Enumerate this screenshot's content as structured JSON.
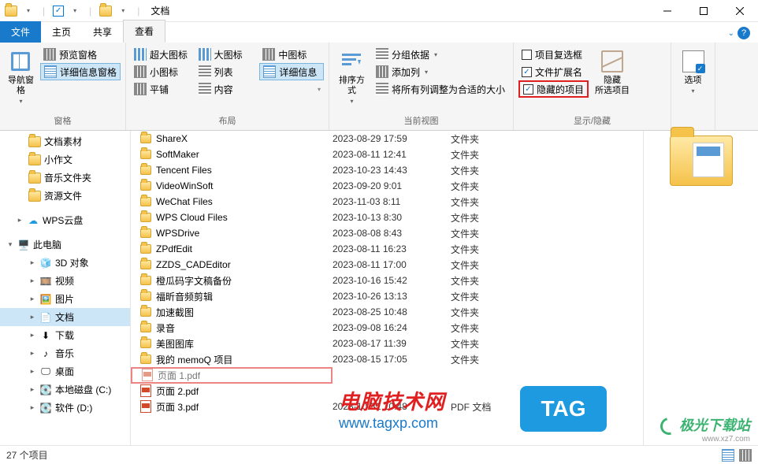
{
  "window": {
    "title": "文档"
  },
  "tabs": {
    "file": "文件",
    "home": "主页",
    "share": "共享",
    "view": "查看"
  },
  "ribbon": {
    "panes": {
      "label": "窗格",
      "nav": "导航窗格",
      "preview": "预览窗格",
      "details": "详细信息窗格"
    },
    "layout": {
      "label": "布局",
      "extra_large": "超大图标",
      "large": "大图标",
      "medium": "中图标",
      "small": "小图标",
      "list": "列表",
      "details": "详细信息",
      "tiles": "平铺",
      "content": "内容"
    },
    "current_view": {
      "label": "当前视图",
      "sort": "排序方式",
      "group": "分组依据",
      "add_columns": "添加列",
      "size_all": "将所有列调整为合适的大小"
    },
    "show_hide": {
      "label": "显示/隐藏",
      "checkboxes": "项目复选框",
      "extensions": "文件扩展名",
      "hidden_items": "隐藏的项目",
      "hide": "隐藏",
      "hide_sub": "所选项目"
    },
    "options": {
      "label": "选项"
    }
  },
  "tree": {
    "items": [
      {
        "icon": "folder",
        "label": "文档素材"
      },
      {
        "icon": "folder",
        "label": "小作文"
      },
      {
        "icon": "folder",
        "label": "音乐文件夹"
      },
      {
        "icon": "folder",
        "label": "资源文件"
      }
    ],
    "wps": "WPS云盘",
    "this_pc": "此电脑",
    "pc_items": [
      {
        "icon": "3d",
        "label": "3D 对象"
      },
      {
        "icon": "video",
        "label": "视频"
      },
      {
        "icon": "image",
        "label": "图片"
      },
      {
        "icon": "doc",
        "label": "文档",
        "selected": true
      },
      {
        "icon": "download",
        "label": "下载"
      },
      {
        "icon": "music",
        "label": "音乐"
      },
      {
        "icon": "desktop",
        "label": "桌面"
      },
      {
        "icon": "disk",
        "label": "本地磁盘 (C:)"
      },
      {
        "icon": "disk",
        "label": "软件 (D:)"
      }
    ]
  },
  "files": [
    {
      "name": "ShareX",
      "date": "2023-08-29 17:59",
      "type": "文件夹",
      "kind": "folder"
    },
    {
      "name": "SoftMaker",
      "date": "2023-08-11 12:41",
      "type": "文件夹",
      "kind": "folder"
    },
    {
      "name": "Tencent Files",
      "date": "2023-10-23 14:43",
      "type": "文件夹",
      "kind": "folder"
    },
    {
      "name": "VideoWinSoft",
      "date": "2023-09-20 9:01",
      "type": "文件夹",
      "kind": "folder"
    },
    {
      "name": "WeChat Files",
      "date": "2023-11-03 8:11",
      "type": "文件夹",
      "kind": "folder"
    },
    {
      "name": "WPS Cloud Files",
      "date": "2023-10-13 8:30",
      "type": "文件夹",
      "kind": "folder"
    },
    {
      "name": "WPSDrive",
      "date": "2023-08-08 8:43",
      "type": "文件夹",
      "kind": "folder"
    },
    {
      "name": "ZPdfEdit",
      "date": "2023-08-11 16:23",
      "type": "文件夹",
      "kind": "folder"
    },
    {
      "name": "ZZDS_CADEditor",
      "date": "2023-08-11 17:00",
      "type": "文件夹",
      "kind": "folder"
    },
    {
      "name": "橙瓜码字文稿备份",
      "date": "2023-10-16 15:42",
      "type": "文件夹",
      "kind": "folder"
    },
    {
      "name": "福昕音频剪辑",
      "date": "2023-10-26 13:13",
      "type": "文件夹",
      "kind": "folder"
    },
    {
      "name": "加速截图",
      "date": "2023-08-25 10:48",
      "type": "文件夹",
      "kind": "folder"
    },
    {
      "name": "录音",
      "date": "2023-09-08 16:24",
      "type": "文件夹",
      "kind": "folder"
    },
    {
      "name": "美图图库",
      "date": "2023-08-17 11:39",
      "type": "文件夹",
      "kind": "folder"
    },
    {
      "name": "我的 memoQ 项目",
      "date": "2023-08-15 17:05",
      "type": "文件夹",
      "kind": "folder"
    },
    {
      "name": "页面 1.pdf",
      "date": "",
      "type": "",
      "kind": "pdf",
      "highlight": true,
      "dimmed": true
    },
    {
      "name": "页面 2.pdf",
      "date": "",
      "type": "",
      "kind": "pdf"
    },
    {
      "name": "页面 3.pdf",
      "date": "2023-10-31 10:48",
      "type": "PDF 文档",
      "kind": "pdf"
    }
  ],
  "status": {
    "count": "27 个项目"
  },
  "watermark": {
    "line1": "电脑技术网",
    "line2": "www.tagxp.com",
    "tag": "TAG",
    "site": "极光下载站",
    "site_url": "www.xz7.com"
  }
}
